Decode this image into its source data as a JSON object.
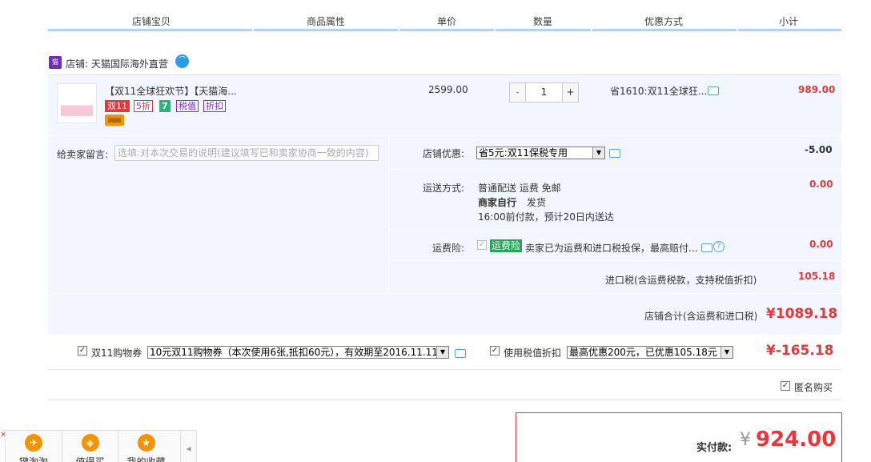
{
  "columns": [
    "店铺宝贝",
    "商品属性",
    "单价",
    "数量",
    "优惠方式",
    "小计"
  ],
  "shop": {
    "label": "店铺: 天猫国际海外直营"
  },
  "product": {
    "title": "【双11全球狂欢节】【天猫海...",
    "price": "2599.00",
    "quantity": "1",
    "qty_minus": "-",
    "qty_plus": "+",
    "discount": "省1610:双11全球狂...",
    "subtotal": "989.00",
    "tags": [
      "双11",
      "5折",
      "7",
      "税值",
      "折扣"
    ]
  },
  "message": {
    "label": "给卖家留言:",
    "placeholder": "选填:对本次交易的说明(建议填写已和卖家协商一致的内容)"
  },
  "shop_discount": {
    "label": "店铺优惠:",
    "selected": "省5元:双11保税专用",
    "amount": "-5.00"
  },
  "shipping": {
    "label": "运送方式:",
    "line1": "普通配送 运费 免邮",
    "line2_bold": "商家自行",
    "line2_rest": "发货",
    "line3": "16:00前付款，预计20日内送达",
    "amount": "0.00"
  },
  "insurance": {
    "label": "运费险:",
    "badge": "运费险",
    "text": "卖家已为运费和进口税投保，最高赔付...",
    "amount": "0.00"
  },
  "import_tax": {
    "label": "进口税(含运费税款，支持税值折扣)",
    "amount": "105.18"
  },
  "shop_total": {
    "label": "店铺合计(含运费和进口税)",
    "amount": "¥1089.18"
  },
  "coupon": {
    "label": "双11购物券",
    "selected": "10元双11购物券（本次使用6张,抵扣60元），有效期至2016.11.11",
    "tax_label": "使用税值折扣",
    "tax_selected": "最高优惠200元，已优惠105.18元",
    "amount": "¥-165.18"
  },
  "anonymous": {
    "label": "匿名购买"
  },
  "pay": {
    "label": "实付款:",
    "currency": "¥",
    "amount": "924.00"
  },
  "bottom_bar": [
    {
      "label": "键淘淘",
      "icon": "plane-icon"
    },
    {
      "label": "值得买",
      "icon": "tag-icon"
    },
    {
      "label": "我的收藏",
      "icon": "star-icon"
    }
  ],
  "colors": {
    "accent_red": "#e4393c",
    "panel_bg": "#f2f7ff",
    "header_bar": "#b2d1ff"
  }
}
